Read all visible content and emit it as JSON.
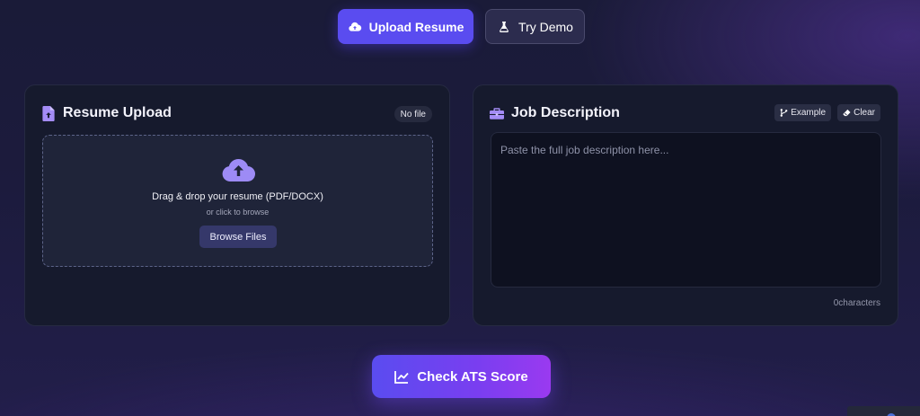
{
  "top_actions": {
    "upload_label": "Upload Resume",
    "demo_label": "Try Demo"
  },
  "resume_card": {
    "title": "Resume Upload",
    "file_status": "No file",
    "dropzone": {
      "main_text": "Drag & drop your resume (PDF/DOCX)",
      "sub_text": "or click to browse",
      "browse_label": "Browse Files"
    }
  },
  "job_card": {
    "title": "Job Description",
    "example_label": "Example",
    "clear_label": "Clear",
    "textarea_placeholder": "Paste the full job description here...",
    "textarea_value": "",
    "char_count": "0characters"
  },
  "check_button": {
    "label": "Check ATS Score"
  },
  "colors": {
    "accent": "#5a4cf0",
    "accent_gradient_end": "#9a3af0",
    "card_bg": "#161a2d",
    "page_bg": "#1c1b3d",
    "icon_purple": "#a48cf6"
  },
  "icons": {
    "upload": "cloud-upload-icon",
    "demo": "flask-icon",
    "resume": "file-upload-icon",
    "job": "briefcase-icon",
    "example": "code-branch-icon",
    "clear": "eraser-icon",
    "check": "chart-line-icon"
  }
}
